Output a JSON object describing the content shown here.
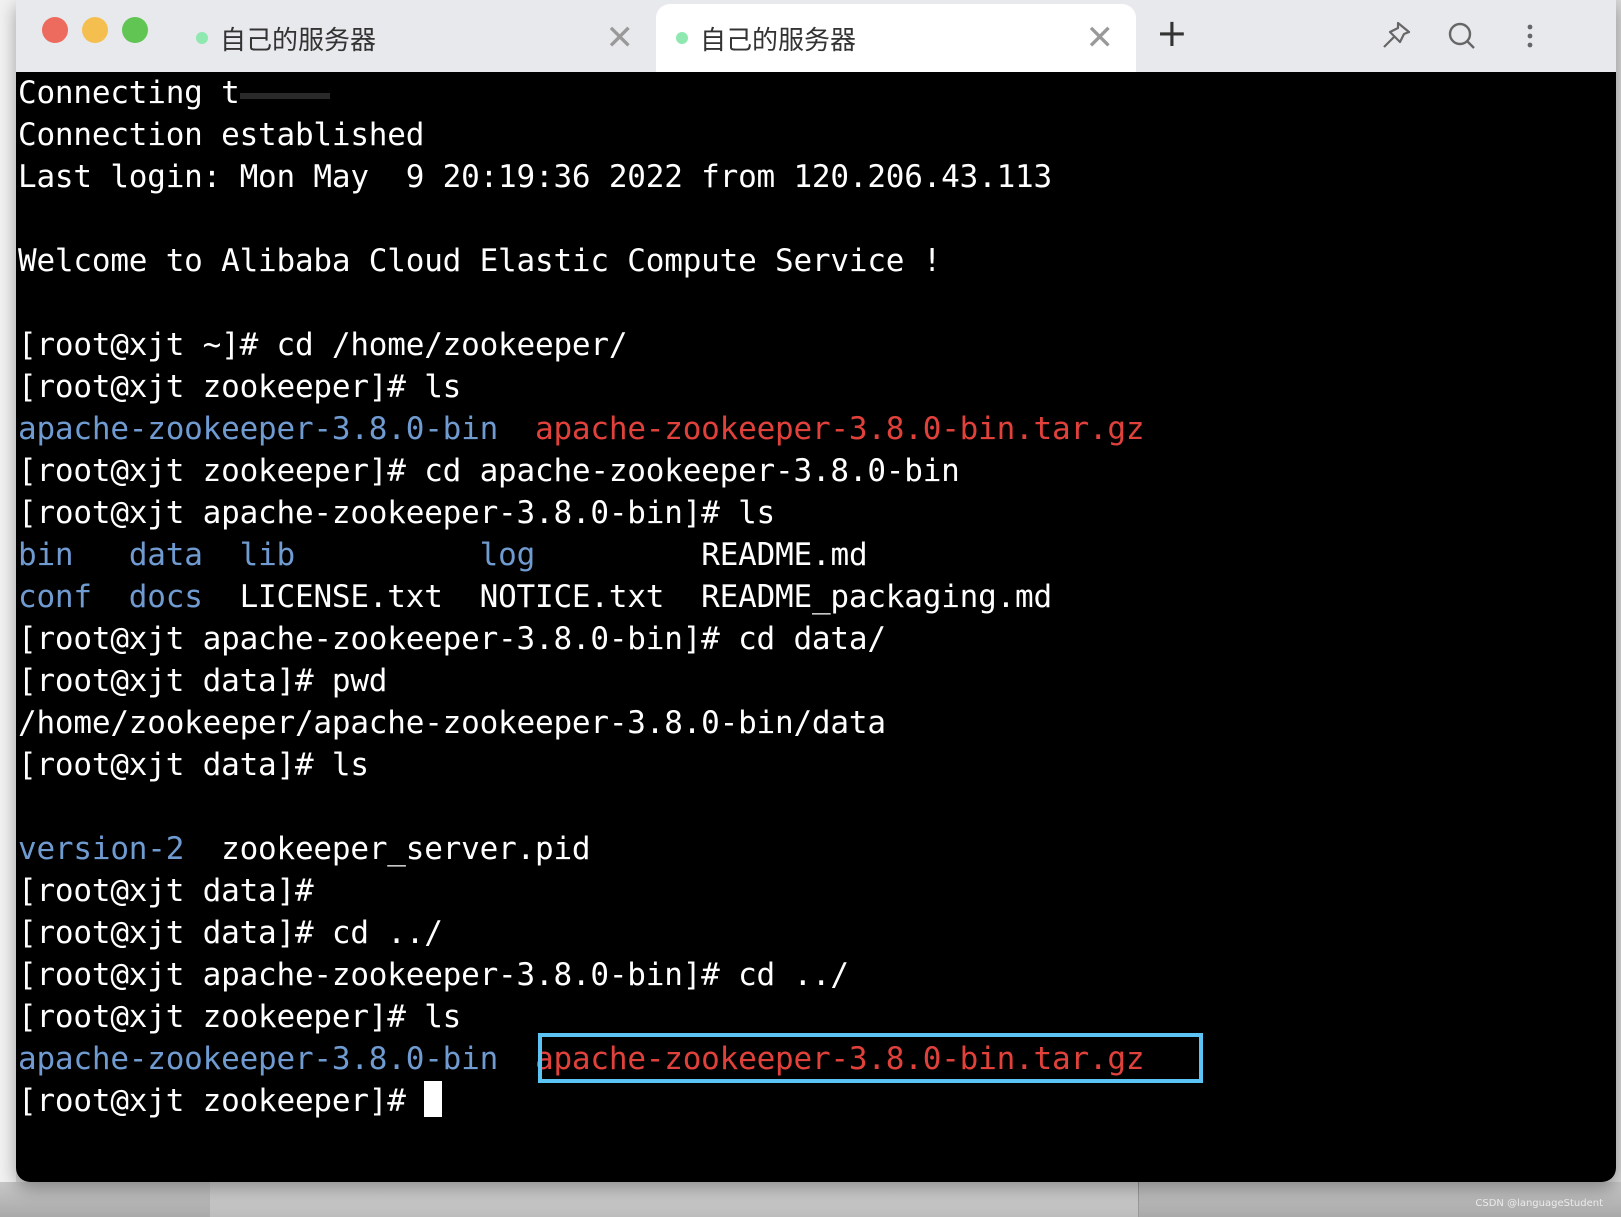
{
  "tabs": [
    {
      "title": "自己的服务器",
      "active": false,
      "status_color": "#8ee8b0"
    },
    {
      "title": "自己的服务器",
      "active": true,
      "status_color": "#8ee8b0"
    }
  ],
  "toolbar": {
    "new_tab_label": "+",
    "icons": [
      "pin-icon",
      "search-icon",
      "more-vertical-icon"
    ]
  },
  "colors": {
    "directory": "#6f9bd1",
    "archive": "#e1413b",
    "highlight": "#5bc4f5",
    "background": "#000000"
  },
  "terminal": {
    "lines": [
      [
        {
          "t": "Connecting t"
        }
      ],
      [
        {
          "t": "Connection established"
        }
      ],
      [
        {
          "t": "Last login: Mon May  9 20:19:36 2022 from 120.206.43.113"
        }
      ],
      [
        {
          "t": ""
        }
      ],
      [
        {
          "t": "Welcome to Alibaba Cloud Elastic Compute Service !"
        }
      ],
      [
        {
          "t": ""
        }
      ],
      [
        {
          "t": "[root@xjt ~]# cd /home/zookeeper/"
        }
      ],
      [
        {
          "t": "[root@xjt zookeeper]# ls"
        }
      ],
      [
        {
          "t": "apache-zookeeper-3.8.0-bin",
          "c": "blue"
        },
        {
          "t": "  "
        },
        {
          "t": "apache-zookeeper-3.8.0-bin.tar.gz",
          "c": "red"
        }
      ],
      [
        {
          "t": "[root@xjt zookeeper]# cd apache-zookeeper-3.8.0-bin"
        }
      ],
      [
        {
          "t": "[root@xjt apache-zookeeper-3.8.0-bin]# ls"
        }
      ],
      [
        {
          "t": "bin",
          "c": "blue"
        },
        {
          "t": "   "
        },
        {
          "t": "data",
          "c": "blue"
        },
        {
          "t": "  "
        },
        {
          "t": "lib",
          "c": "blue"
        },
        {
          "t": "          "
        },
        {
          "t": "log",
          "c": "blue"
        },
        {
          "t": "         README.md"
        }
      ],
      [
        {
          "t": "conf",
          "c": "blue"
        },
        {
          "t": "  "
        },
        {
          "t": "docs",
          "c": "blue"
        },
        {
          "t": "  LICENSE.txt  NOTICE.txt  README_packaging.md"
        }
      ],
      [
        {
          "t": "[root@xjt apache-zookeeper-3.8.0-bin]# cd data/"
        }
      ],
      [
        {
          "t": "[root@xjt data]# pwd"
        }
      ],
      [
        {
          "t": "/home/zookeeper/apache-zookeeper-3.8.0-bin/data"
        }
      ],
      [
        {
          "t": "[root@xjt data]# ls"
        }
      ],
      [
        {
          "t": ""
        }
      ],
      [
        {
          "t": "version-2",
          "c": "blue"
        },
        {
          "t": "  zookeeper_server.pid"
        }
      ],
      [
        {
          "t": "[root@xjt data]#"
        }
      ],
      [
        {
          "t": "[root@xjt data]# cd ../"
        }
      ],
      [
        {
          "t": "[root@xjt apache-zookeeper-3.8.0-bin]# cd ../"
        }
      ],
      [
        {
          "t": "[root@xjt zookeeper]# ls"
        }
      ],
      [
        {
          "t": "apache-zookeeper-3.8.0-bin",
          "c": "blue"
        },
        {
          "t": "  "
        },
        {
          "t": "apache-zookeeper-3.8.0-bin.tar.gz",
          "c": "red"
        }
      ],
      [
        {
          "t": "[root@xjt zookeeper]# "
        }
      ]
    ]
  },
  "watermark": "CSDN @languageStudent"
}
